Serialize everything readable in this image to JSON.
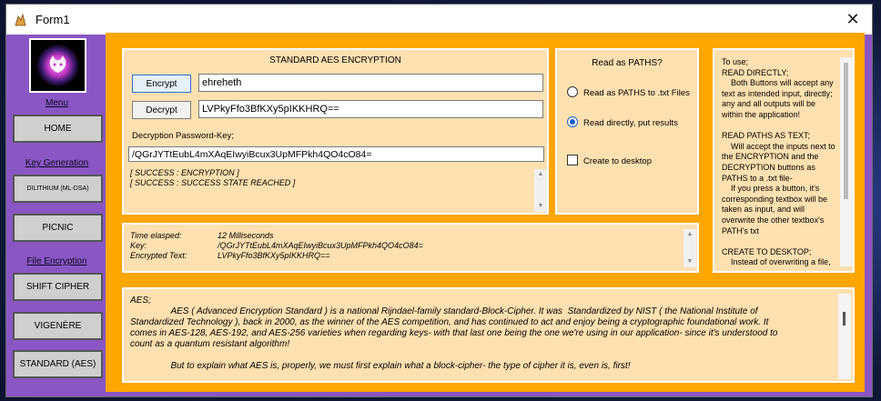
{
  "window": {
    "title": "Form1",
    "close_glyph": "✕"
  },
  "sidebar": {
    "menu_label": "Menu",
    "home_label": "HOME",
    "key_generation_label": "Key Generation",
    "dilithium_label": "DILITHIUM (ML-DSA)",
    "picnic_label": "PICNIC",
    "file_encryption_label": "File Encryption",
    "shift_cipher_label": "SHIFT CIPHER",
    "vigenere_label": "VIGENÈRE",
    "standard_aes_label": "STANDARD (AES)"
  },
  "aes": {
    "title": "STANDARD AES ENCRYPTION",
    "encrypt_label": "Encrypt",
    "encrypt_value": "ehreheth",
    "decrypt_label": "Decrypt",
    "decrypt_value": "LVPkyFfo3BfKXy5pIKKHRQ==",
    "password_label": "Decryption Password-Key;",
    "password_value": "/QGrJYTtEubL4mXAqEIwyiBcux3UpMFPkh4QO4cO84=",
    "status_lines": [
      "[ SUCCESS : ENCRYPTION ]",
      "[ SUCCESS : SUCCESS STATE REACHED ]"
    ]
  },
  "options": {
    "title": "Read as PATHS?",
    "radio_paths_label": "Read as PATHS to .txt Files",
    "radio_direct_label": "Read directly, put results",
    "desktop_label": "Create to desktop"
  },
  "results": {
    "rows": [
      {
        "key": "Time elasped:",
        "value": "12 Milliseconds"
      },
      {
        "key": "Key:",
        "value": "/QGrJYTtEubL4mXAqEIwyiBcux3UpMFPkh4QO4cO84="
      },
      {
        "key": "Encrypted Text:",
        "value": "LVPkyFfo3BfKXy5pIKKHRQ=="
      }
    ]
  },
  "help": {
    "text": "To use;\nREAD DIRECTLY;\n    Both Buttons will accept any\ntext as intended input, directly;\nany and all outputs will be\nwithin the application!\n\nREAD PATHS AS TEXT;\n    Will accept the inputs next to\nthe ENCRYPTION and the\nDECRYPTION buttons as\nPATHS to a .txt file-\n    If you press a button, it's\ncorresponding textbox will be\ntaken as input, and will\noverwrite the other textbox's\nPATH's txt\n\nCREATE TO DESKTOP;\n    Instead of overwriting a file,"
  },
  "about": {
    "text": "AES;\n                AES ( Advanced Encryption Standard ) is a national Rijndael-family standard-Block-Cipher. It was  Standardized by NIST ( the National Institute of\nStandardized Technology ), back in 2000, as the winner of the AES competition, and has continued to act and enjoy being a cryptographic foundational work. It\ncomes in AES-128, AES-192, and AES-256 varieties when regarding keys- with that last one being the one we're using in our application- since it's understood to\ncount as a quantum resistant algorithm!\n\n                But to explain what AES is, properly, we must first explain what a block-cipher- the type of cipher it is, even is, first!"
  },
  "colors": {
    "sidebar": "#8a56c4",
    "main": "#ffa600",
    "panel": "#ffe0b0",
    "accent": "#1a5fd0"
  }
}
